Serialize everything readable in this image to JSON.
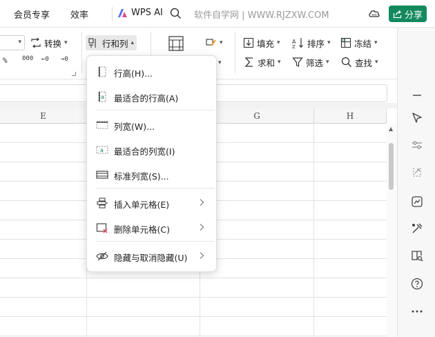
{
  "topbar": {
    "menu_member": "会员专享",
    "menu_efficiency": "效率",
    "wps_ai": "WPS AI",
    "watermark": "软件自学网 | WWW.RJZXW.COM",
    "share": "分享"
  },
  "ribbon": {
    "convert": "转换",
    "row_col": "行和列",
    "fill": "填充",
    "sort": "排序",
    "freeze": "冻结",
    "sum": "求和",
    "filter": "筛选",
    "find": "查找",
    "fmt_percent": "%",
    "fmt_thousands": "000",
    "fmt_inc_decimal": "←0",
    "fmt_dec_decimal": "→0"
  },
  "grid": {
    "col_e": "E",
    "col_g": "G",
    "col_h": "H"
  },
  "dropdown": {
    "row_height": "行高(H)...",
    "best_row_height": "最适合的行高(A)",
    "col_width": "列宽(W)...",
    "best_col_width": "最适合的列宽(I)",
    "std_col_width": "标准列宽(S)...",
    "insert_cells": "插入单元格(E)",
    "delete_cells": "删除单元格(C)",
    "hide_unhide": "隐藏与取消隐藏(U)"
  },
  "colors": {
    "share_green": "#138a5e",
    "accent_red": "#e0454b"
  }
}
